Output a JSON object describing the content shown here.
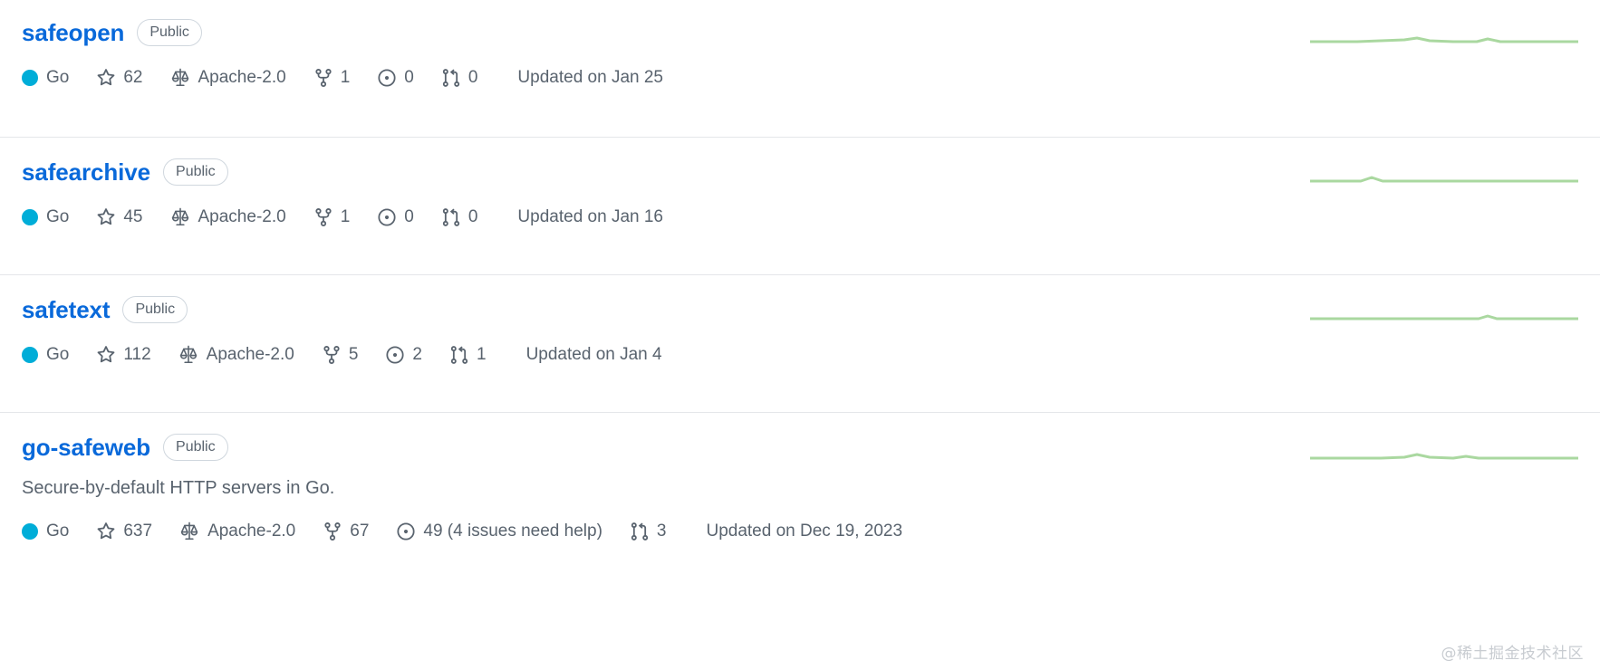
{
  "colors": {
    "link": "#0969da",
    "muted": "#59636e",
    "border": "#e4e6ea",
    "badge_border": "#d0d7de",
    "go_language": "#00ADD8",
    "sparkline": "#aad8a0",
    "watermark": "#c8ccd1"
  },
  "labels": {
    "star_icon": "star-icon",
    "license_icon": "law-scale-icon",
    "fork_icon": "repo-forked-icon",
    "issue_icon": "issue-opened-icon",
    "pull_icon": "git-pull-request-icon"
  },
  "watermark": "@稀土掘金技术社区",
  "repositories": [
    {
      "name": "safeopen",
      "visibility": "Public",
      "description": "",
      "language": "Go",
      "language_color": "#00ADD8",
      "stars": "62",
      "license": "Apache-2.0",
      "forks": "1",
      "issues": "0",
      "pulls": "0",
      "updated": "Updated on Jan 25",
      "sparkline": "0,20 26,20 52,20 78,19 104,18 118,16 132,19 158,20 184,20 196,17 210,20 240,20 270,20 296,20"
    },
    {
      "name": "safearchive",
      "visibility": "Public",
      "description": "",
      "language": "Go",
      "language_color": "#00ADD8",
      "stars": "45",
      "license": "Apache-2.0",
      "forks": "1",
      "issues": "0",
      "pulls": "0",
      "updated": "Updated on Jan 16",
      "sparkline": "0,20 30,20 56,20 68,16 80,20 110,20 150,20 190,20 230,20 260,20 296,20"
    },
    {
      "name": "safetext",
      "visibility": "Public",
      "description": "",
      "language": "Go",
      "language_color": "#00ADD8",
      "stars": "112",
      "license": "Apache-2.0",
      "forks": "5",
      "issues": "2",
      "pulls": "1",
      "updated": "Updated on Jan 4",
      "sparkline": "0,20 40,20 80,20 120,20 160,20 186,20 196,17 206,20 240,20 270,20 296,20"
    },
    {
      "name": "go-safeweb",
      "visibility": "Public",
      "description": "Secure-by-default HTTP servers in Go.",
      "language": "Go",
      "language_color": "#00ADD8",
      "stars": "637",
      "license": "Apache-2.0",
      "forks": "67",
      "issues": "49 (4 issues need help)",
      "pulls": "3",
      "updated": "Updated on Dec 19, 2023",
      "sparkline": "0,20 26,20 52,20 78,20 104,19 118,16 132,19 158,20 172,18 186,20 212,20 240,20 268,20 296,20"
    }
  ]
}
